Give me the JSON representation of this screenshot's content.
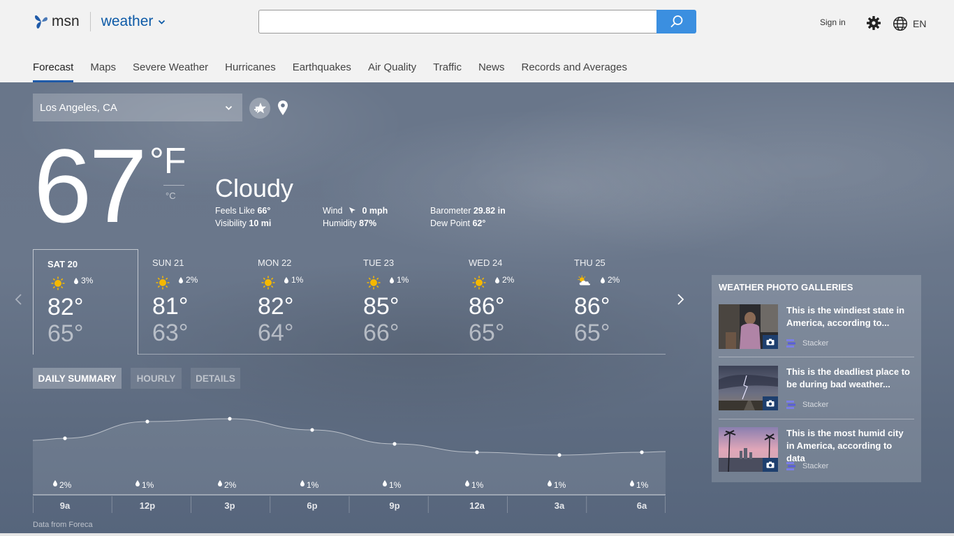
{
  "header": {
    "brand": "msn",
    "product": "weather",
    "search_placeholder": "",
    "signin": "Sign in",
    "lang": "EN"
  },
  "nav": {
    "tabs": [
      "Forecast",
      "Maps",
      "Severe Weather",
      "Hurricanes",
      "Earthquakes",
      "Air Quality",
      "Traffic",
      "News",
      "Records and Averages"
    ]
  },
  "location": {
    "selected": "Los Angeles, CA"
  },
  "current": {
    "temp": "67",
    "unit_f": "°F",
    "unit_c": "°C",
    "condition": "Cloudy",
    "feels_like_label": "Feels Like",
    "feels_like": "66°",
    "visibility_label": "Visibility",
    "visibility": "10 mi",
    "wind_label": "Wind",
    "wind": "0 mph",
    "humidity_label": "Humidity",
    "humidity": "87%",
    "barometer_label": "Barometer",
    "barometer": "29.82 in",
    "dew_point_label": "Dew Point",
    "dew_point": "62°"
  },
  "forecast": [
    {
      "day": "SAT 20",
      "icon": "sun-icon",
      "precip": "3%",
      "hi": "82°",
      "lo": "65°"
    },
    {
      "day": "SUN 21",
      "icon": "sun-icon",
      "precip": "2%",
      "hi": "81°",
      "lo": "63°"
    },
    {
      "day": "MON 22",
      "icon": "sun-icon",
      "precip": "1%",
      "hi": "82°",
      "lo": "64°"
    },
    {
      "day": "TUE 23",
      "icon": "sun-icon",
      "precip": "1%",
      "hi": "85°",
      "lo": "66°"
    },
    {
      "day": "WED 24",
      "icon": "sun-icon",
      "precip": "2%",
      "hi": "86°",
      "lo": "65°"
    },
    {
      "day": "THU 25",
      "icon": "partly-cloudy-icon",
      "precip": "2%",
      "hi": "86°",
      "lo": "65°"
    }
  ],
  "summary_tabs": [
    "DAILY SUMMARY",
    "HOURLY",
    "DETAILS"
  ],
  "chart_data": {
    "type": "line",
    "x": [
      "9a",
      "12p",
      "3p",
      "6p",
      "9p",
      "12a",
      "3a",
      "6a"
    ],
    "precip": [
      "2%",
      "1%",
      "2%",
      "1%",
      "1%",
      "1%",
      "1%",
      "1%"
    ],
    "series": [
      {
        "values": [
          73,
          79,
          80,
          76,
          71,
          68,
          67,
          68
        ]
      }
    ],
    "ylim": [
      60,
      85
    ],
    "grid": false
  },
  "source_note": "Data from Foreca",
  "galleries": {
    "title": "WEATHER PHOTO GALLERIES",
    "items": [
      {
        "title": "This is the windiest state in America, according to...",
        "source": "Stacker"
      },
      {
        "title": "This is the deadliest place to be during bad weather...",
        "source": "Stacker"
      },
      {
        "title": "This is the most humid city in America, according to data",
        "source": "Stacker"
      }
    ]
  },
  "colors": {
    "accent": "#1f5aa8",
    "search_button": "#3b8fe0",
    "sun": "#f5b800"
  }
}
